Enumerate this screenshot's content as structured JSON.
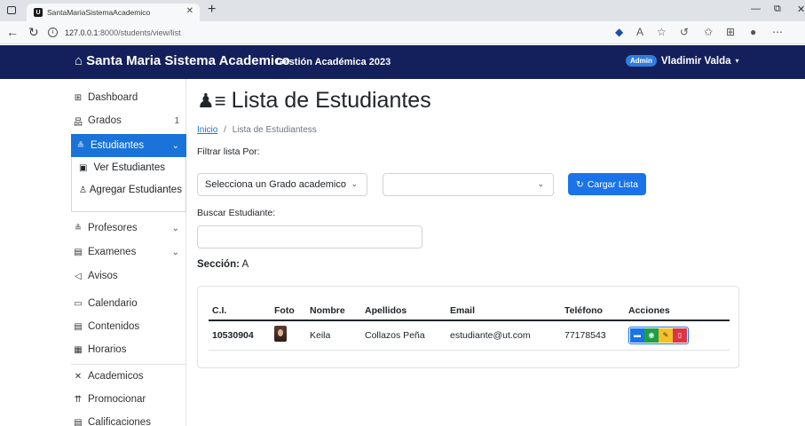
{
  "browser": {
    "tab_title": "SantaMariaSistemaAcademico",
    "url_host": "127.0.0.1",
    "url_path": ":8000/students/view/list"
  },
  "navbar": {
    "brand": "Santa Maria Sistema Academico",
    "subtitle": "Gestión Académica 2023",
    "role_badge": "Admin",
    "user_name": "Vladimir Valda"
  },
  "sidebar": {
    "items": [
      {
        "label": "Dashboard",
        "icon": "grid-icon"
      },
      {
        "label": "Grados",
        "icon": "hierarchy-icon",
        "count": "1"
      },
      {
        "label": "Estudiantes",
        "icon": "students-icon"
      },
      {
        "label": "Profesores",
        "icon": "teachers-icon"
      },
      {
        "label": "Examenes",
        "icon": "document-icon"
      },
      {
        "label": "Avisos",
        "icon": "megaphone-icon"
      },
      {
        "label": "Calendario",
        "icon": "calendar-icon"
      },
      {
        "label": "Contenidos",
        "icon": "file-icon"
      },
      {
        "label": "Horarios",
        "icon": "schedule-icon"
      },
      {
        "label": "Academicos",
        "icon": "tools-icon"
      },
      {
        "label": "Promocionar",
        "icon": "arrows-up-icon"
      },
      {
        "label": "Calificaciones",
        "icon": "table-icon"
      }
    ],
    "submenu": {
      "ver": "Ver Estudiantes",
      "agregar": "Agregar Estudiantes"
    }
  },
  "main": {
    "title": "Lista de Estudiantes",
    "breadcrumb_home": "Inicio",
    "breadcrumb_sep": "/",
    "breadcrumb_current": "Lista de Estudiantess",
    "filter_label": "Filtrar lista Por:",
    "grade_select": "Selecciona un Grado academico",
    "second_select": "",
    "load_button": "Cargar Lista",
    "search_label": "Buscar Estudiante:",
    "search_value": "",
    "section_label": "Sección:",
    "section_value": "A"
  },
  "table": {
    "headers": [
      "C.I.",
      "Foto",
      "Nombre",
      "Apellidos",
      "Email",
      "Teléfono",
      "Acciones"
    ],
    "rows": [
      {
        "ci": "10530904",
        "nombre": "Keila",
        "apellidos": "Collazos Peña",
        "email": "estudiante@ut.com",
        "telefono": "77178543"
      }
    ]
  },
  "colors": {
    "navbar": "#13205b",
    "accent": "#1a73d9",
    "success": "#1e9e4a",
    "warning": "#f6c026",
    "danger": "#dc3545"
  }
}
